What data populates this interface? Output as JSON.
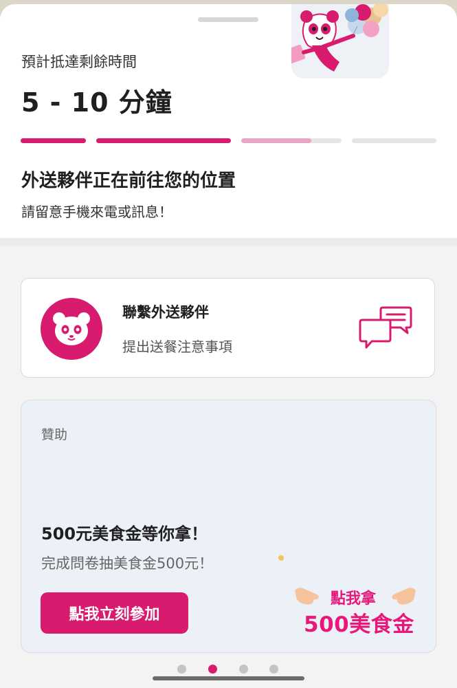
{
  "eta": {
    "label": "預計抵達剩餘時間",
    "time": "5 - 10 分鐘",
    "progress_steps": [
      1,
      1,
      0.7,
      0
    ]
  },
  "status": {
    "title": "外送夥伴正在前往您的位置",
    "subtitle": "請留意手機來電或訊息！"
  },
  "contact": {
    "title": "聯繫外送夥伴",
    "subtitle": "提出送餐注意事項",
    "icon": "chat-bubbles-icon"
  },
  "promo": {
    "sponsor_label": "贊助",
    "title": "500元美食金等你拿！",
    "subtitle": "完成問卷抽美食金500元！",
    "button_label": "點我立刻參加",
    "art_small": "點我拿",
    "art_big": "500美食金"
  },
  "pager": {
    "count": 4,
    "active_index": 1
  },
  "colors": {
    "brand": "#d81b6f",
    "progress_partial": "#e6a7c4",
    "track": "#e5e5e5"
  }
}
